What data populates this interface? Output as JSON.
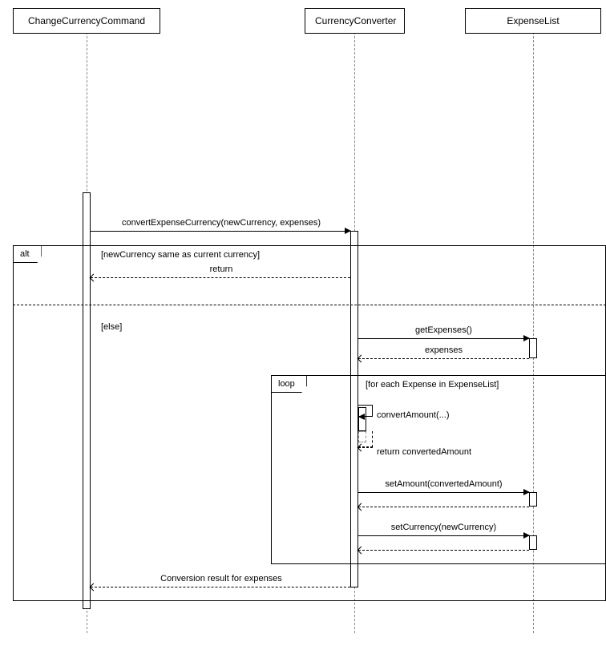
{
  "participants": {
    "p1": "ChangeCurrencyCommand",
    "p2": "CurrencyConverter",
    "p3": "ExpenseList"
  },
  "messages": {
    "m1": "convertExpenseCurrency(newCurrency, expenses)",
    "m2": "return",
    "m3": "getExpenses()",
    "m4": "expenses",
    "m5": "convertAmount(...)",
    "m6": "return convertedAmount",
    "m7": "setAmount(convertedAmount)",
    "m8": "setCurrency(newCurrency)",
    "m9": "Conversion result for expenses"
  },
  "fragments": {
    "alt": "alt",
    "loop": "loop"
  },
  "guards": {
    "g1": "[newCurrency same as current currency]",
    "g2": "[else]",
    "g3": "[for each Expense in ExpenseList]"
  }
}
